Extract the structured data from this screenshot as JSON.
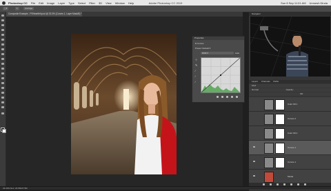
{
  "menubar": {
    "app": "Photoshop CC",
    "items": [
      "File",
      "Edit",
      "Image",
      "Layer",
      "Type",
      "Select",
      "Filter",
      "3D",
      "View",
      "Window",
      "Help"
    ],
    "window_title": "Adobe Photoshop CC 2019",
    "clock": "Sun 8 Sep 11:01 AM",
    "user": "Unmesh Dinda"
  },
  "options": {
    "auto_select": "1",
    "mode": "Average"
  },
  "document": {
    "tab_title": "Composite Example - PSHeartfelt.psd @ 33.3% (Curves 1, Layer Mask/8) *"
  },
  "properties": {
    "title": "Properties",
    "section": "Curves",
    "preset_label": "Preset:",
    "preset_value": "Default",
    "channel_value": "RGB",
    "auto_label": "Auto"
  },
  "navigator": {
    "tab": "Navigator"
  },
  "layers": {
    "tabs": [
      "Layers",
      "Channels",
      "Paths"
    ],
    "kind_label": "Kind",
    "mode_label": "Normal",
    "opacity_label": "Opacity:",
    "fill_label": "Fill:",
    "rows": [
      {
        "name": "Color Fill 1"
      },
      {
        "name": "Curves 2"
      },
      {
        "name": "Color Fill 2"
      },
      {
        "name": "Curves 1"
      },
      {
        "name": "Curves 1"
      },
      {
        "name": "Model"
      }
    ]
  },
  "status": {
    "text": "33.33%   Doc: 23.5M/47.5M"
  },
  "colors": {
    "accent": "#d11b1b",
    "panel": "#363636",
    "canvas_bg": "#262626"
  }
}
